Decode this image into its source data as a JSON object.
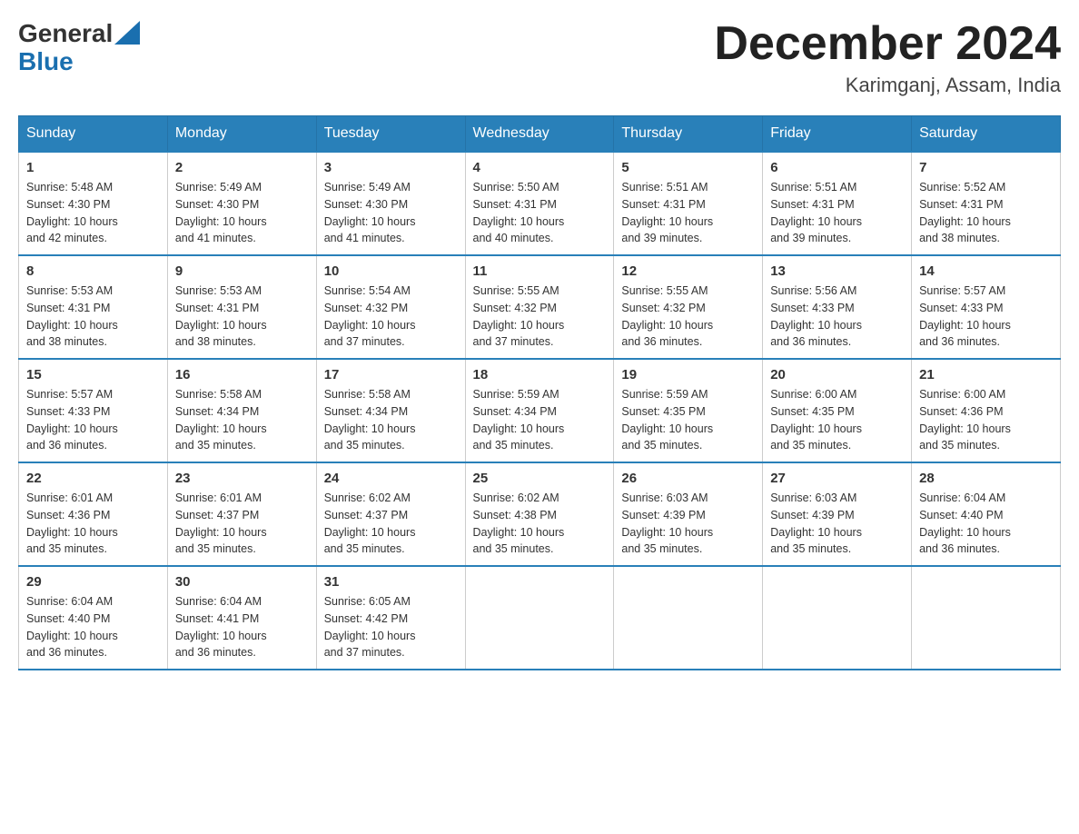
{
  "header": {
    "logo": {
      "general": "General",
      "blue": "Blue"
    },
    "title": "December 2024",
    "location": "Karimganj, Assam, India"
  },
  "days_of_week": [
    "Sunday",
    "Monday",
    "Tuesday",
    "Wednesday",
    "Thursday",
    "Friday",
    "Saturday"
  ],
  "weeks": [
    [
      {
        "day": "1",
        "sunrise": "5:48 AM",
        "sunset": "4:30 PM",
        "daylight": "10 hours and 42 minutes."
      },
      {
        "day": "2",
        "sunrise": "5:49 AM",
        "sunset": "4:30 PM",
        "daylight": "10 hours and 41 minutes."
      },
      {
        "day": "3",
        "sunrise": "5:49 AM",
        "sunset": "4:30 PM",
        "daylight": "10 hours and 41 minutes."
      },
      {
        "day": "4",
        "sunrise": "5:50 AM",
        "sunset": "4:31 PM",
        "daylight": "10 hours and 40 minutes."
      },
      {
        "day": "5",
        "sunrise": "5:51 AM",
        "sunset": "4:31 PM",
        "daylight": "10 hours and 39 minutes."
      },
      {
        "day": "6",
        "sunrise": "5:51 AM",
        "sunset": "4:31 PM",
        "daylight": "10 hours and 39 minutes."
      },
      {
        "day": "7",
        "sunrise": "5:52 AM",
        "sunset": "4:31 PM",
        "daylight": "10 hours and 38 minutes."
      }
    ],
    [
      {
        "day": "8",
        "sunrise": "5:53 AM",
        "sunset": "4:31 PM",
        "daylight": "10 hours and 38 minutes."
      },
      {
        "day": "9",
        "sunrise": "5:53 AM",
        "sunset": "4:31 PM",
        "daylight": "10 hours and 38 minutes."
      },
      {
        "day": "10",
        "sunrise": "5:54 AM",
        "sunset": "4:32 PM",
        "daylight": "10 hours and 37 minutes."
      },
      {
        "day": "11",
        "sunrise": "5:55 AM",
        "sunset": "4:32 PM",
        "daylight": "10 hours and 37 minutes."
      },
      {
        "day": "12",
        "sunrise": "5:55 AM",
        "sunset": "4:32 PM",
        "daylight": "10 hours and 36 minutes."
      },
      {
        "day": "13",
        "sunrise": "5:56 AM",
        "sunset": "4:33 PM",
        "daylight": "10 hours and 36 minutes."
      },
      {
        "day": "14",
        "sunrise": "5:57 AM",
        "sunset": "4:33 PM",
        "daylight": "10 hours and 36 minutes."
      }
    ],
    [
      {
        "day": "15",
        "sunrise": "5:57 AM",
        "sunset": "4:33 PM",
        "daylight": "10 hours and 36 minutes."
      },
      {
        "day": "16",
        "sunrise": "5:58 AM",
        "sunset": "4:34 PM",
        "daylight": "10 hours and 35 minutes."
      },
      {
        "day": "17",
        "sunrise": "5:58 AM",
        "sunset": "4:34 PM",
        "daylight": "10 hours and 35 minutes."
      },
      {
        "day": "18",
        "sunrise": "5:59 AM",
        "sunset": "4:34 PM",
        "daylight": "10 hours and 35 minutes."
      },
      {
        "day": "19",
        "sunrise": "5:59 AM",
        "sunset": "4:35 PM",
        "daylight": "10 hours and 35 minutes."
      },
      {
        "day": "20",
        "sunrise": "6:00 AM",
        "sunset": "4:35 PM",
        "daylight": "10 hours and 35 minutes."
      },
      {
        "day": "21",
        "sunrise": "6:00 AM",
        "sunset": "4:36 PM",
        "daylight": "10 hours and 35 minutes."
      }
    ],
    [
      {
        "day": "22",
        "sunrise": "6:01 AM",
        "sunset": "4:36 PM",
        "daylight": "10 hours and 35 minutes."
      },
      {
        "day": "23",
        "sunrise": "6:01 AM",
        "sunset": "4:37 PM",
        "daylight": "10 hours and 35 minutes."
      },
      {
        "day": "24",
        "sunrise": "6:02 AM",
        "sunset": "4:37 PM",
        "daylight": "10 hours and 35 minutes."
      },
      {
        "day": "25",
        "sunrise": "6:02 AM",
        "sunset": "4:38 PM",
        "daylight": "10 hours and 35 minutes."
      },
      {
        "day": "26",
        "sunrise": "6:03 AM",
        "sunset": "4:39 PM",
        "daylight": "10 hours and 35 minutes."
      },
      {
        "day": "27",
        "sunrise": "6:03 AM",
        "sunset": "4:39 PM",
        "daylight": "10 hours and 35 minutes."
      },
      {
        "day": "28",
        "sunrise": "6:04 AM",
        "sunset": "4:40 PM",
        "daylight": "10 hours and 36 minutes."
      }
    ],
    [
      {
        "day": "29",
        "sunrise": "6:04 AM",
        "sunset": "4:40 PM",
        "daylight": "10 hours and 36 minutes."
      },
      {
        "day": "30",
        "sunrise": "6:04 AM",
        "sunset": "4:41 PM",
        "daylight": "10 hours and 36 minutes."
      },
      {
        "day": "31",
        "sunrise": "6:05 AM",
        "sunset": "4:42 PM",
        "daylight": "10 hours and 37 minutes."
      },
      null,
      null,
      null,
      null
    ]
  ],
  "labels": {
    "sunrise": "Sunrise:",
    "sunset": "Sunset:",
    "daylight": "Daylight:"
  }
}
